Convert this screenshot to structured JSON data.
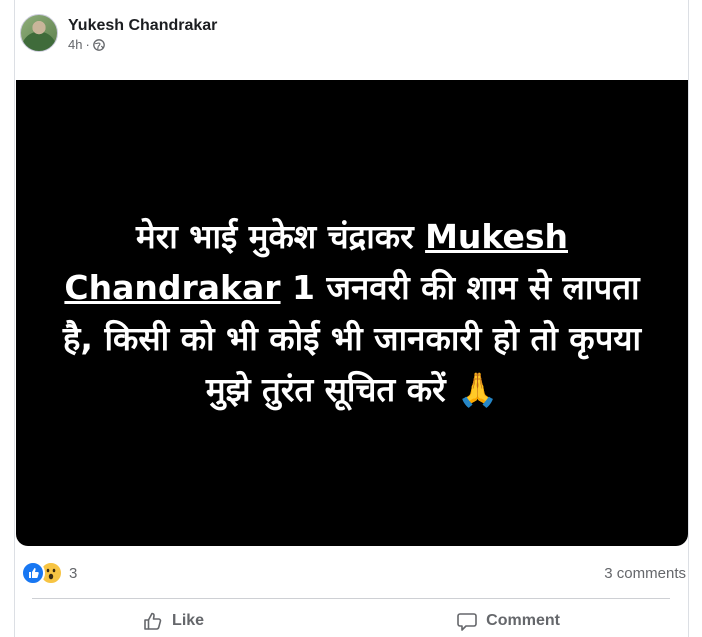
{
  "post": {
    "author": "Yukesh Chandrakar",
    "time": "4h",
    "time_separator": "·",
    "privacy_icon": "globe-icon",
    "media_text": {
      "before_link": "मेरा भाई मुकेश चंद्राकर ",
      "link": "Mukesh Chandrakar",
      "after_link": " 1 जनवरी की शाम से लापता है, किसी को भी कोई भी जानकारी हो तो कृपया मुझे तुरंत सूचित करें ",
      "emoji": "🙏"
    }
  },
  "stats": {
    "reaction_icons": [
      "like-reaction-icon",
      "wow-reaction-icon"
    ],
    "reaction_count": "3",
    "comments": "3 comments"
  },
  "actions": {
    "like": "Like",
    "comment": "Comment"
  },
  "colors": {
    "media_bg": "#000000",
    "like_blue": "#1877f2",
    "wow_yellow": "#f7c443",
    "secondary_text": "#65676b"
  }
}
